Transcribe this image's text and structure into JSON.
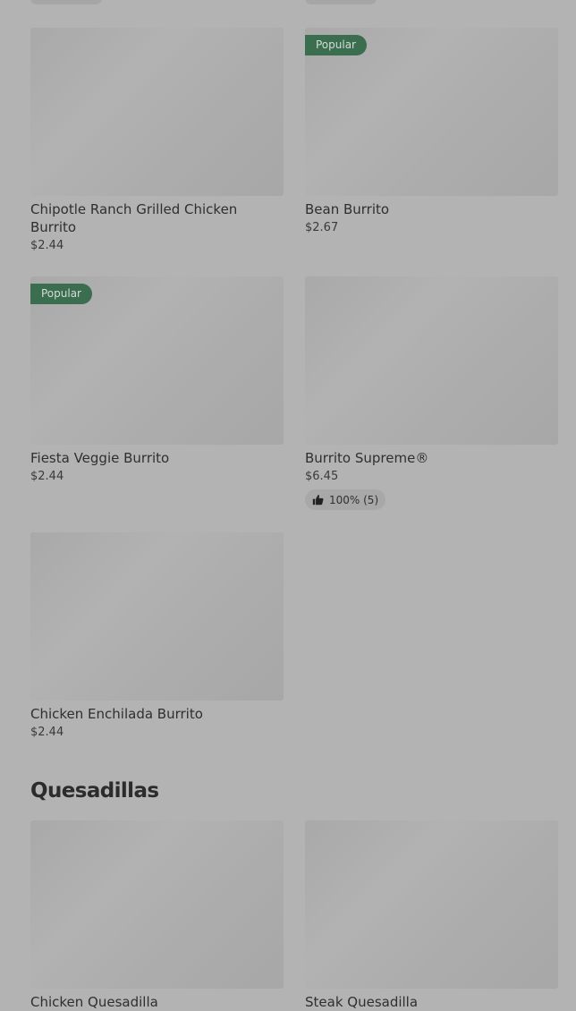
{
  "menu": {
    "burritos": {
      "items": [
        {
          "name": "Chipotle Ranch Grilled Chicken Burrito",
          "price": "$2.44"
        },
        {
          "name": "Bean Burrito",
          "price": "$2.67",
          "badge": "Popular"
        },
        {
          "name": "Fiesta Veggie Burrito",
          "price": "$2.44",
          "badge": "Popular"
        },
        {
          "name": "Burrito Supreme®",
          "price": "$6.45",
          "rating": "100% (5)"
        },
        {
          "name": "Chicken Enchilada Burrito",
          "price": "$2.44"
        }
      ]
    },
    "quesadillas": {
      "title": "Quesadillas",
      "items": [
        {
          "name": "Chicken Quesadilla"
        },
        {
          "name": "Steak Quesadilla"
        }
      ]
    }
  },
  "icons": {
    "thumbs_up": "thumbs-up-icon"
  },
  "colors": {
    "popular_badge": "#3b6d4f",
    "overlay_background": "#b3b3b3"
  }
}
